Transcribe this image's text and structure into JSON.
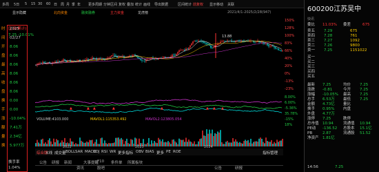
{
  "toolbar": {
    "items": [
      "多周",
      "5日",
      "5",
      "15",
      "30",
      "60",
      "日",
      "周",
      "月",
      "季",
      "年",
      "更多周期",
      "分钟区间",
      "复权",
      "叠加",
      "统计",
      "画线",
      "导出数据",
      "区间统计",
      "前复权",
      "显示移动",
      "关联"
    ],
    "active_index": 19
  },
  "toolbar2": {
    "items": [
      "显示隐藏",
      "北向资金",
      "融资融券",
      "主力资金",
      "龙虎榜"
    ],
    "date_range": "2021/4/1-2025/2/28(947)"
  },
  "left_panel": {
    "header": "区间(累计)",
    "subheader": "7.25 -10.01%",
    "rows": [
      {
        "label": "时",
        "value": "2025"
      },
      {
        "label": "间",
        "value": "02/27"
      },
      {
        "label": "开",
        "value": "8.06"
      },
      {
        "label": "盘",
        "value": "8.06"
      },
      {
        "label": "最",
        "value": "8.06"
      },
      {
        "label": "高",
        "value": "8.06"
      },
      {
        "label": "收",
        "value": "8.06"
      },
      {
        "label": "盘",
        "value": "8.06"
      },
      {
        "label": "换",
        "value": "0.00"
      },
      {
        "label": "手",
        "value": "0.00"
      },
      {
        "label": "涨",
        "value": "-10.04%"
      },
      {
        "label": "额",
        "value": "7.41万"
      },
      {
        "label": "量",
        "value": "2.34亿"
      },
      {
        "label": "换",
        "value": "5.977万"
      }
    ],
    "footer_label": "换手率",
    "footer_value": "1.04%"
  },
  "chart": {
    "peak_label": "13.88",
    "low_label": "5.70",
    "volume_title": "VOLUME:4103.000",
    "mavol1": "MAVOL1:115353.492",
    "mavol2": "MAVOL2:123805.054",
    "year_labels": [
      "2022",
      "2023",
      "2024"
    ],
    "legend_label": "日K叠加: 17.83"
  },
  "y_axis": {
    "price_ticks": [
      "150%",
      "128%",
      "100%",
      "83%",
      "66%",
      "40%",
      "20%",
      "0%",
      "-13%",
      "-23%"
    ],
    "vol_ticks": [
      "8.00%",
      "6.00%",
      "-5.36%",
      "35.78%",
      "-15%",
      "18%"
    ]
  },
  "tabs": {
    "items": [
      "综合版",
      "K线",
      "成交量",
      "BOLL",
      "SAR",
      "MACD",
      "KDJ",
      "RSI",
      "WR",
      "更多指标",
      "OBV",
      "BIAS",
      "更多",
      "PE",
      "ROE"
    ],
    "right_button": "指标管理"
  },
  "bottom_tabs": {
    "items": [
      "公告",
      "研报",
      "新闻",
      "大事提醒",
      "F10",
      "条件单",
      "所属板块"
    ]
  },
  "status": {
    "left": "资讯",
    "mid": "股吧",
    "right1": "公告",
    "right2": "研报"
  },
  "stock": {
    "code": "600200",
    "name": "江苏吴中",
    "subtitle": "快讯",
    "order_book_header": [
      "委比",
      "11.03%",
      "委差",
      "675"
    ],
    "asks": [
      {
        "label": "卖五",
        "price": "7.29",
        "vol": "675"
      },
      {
        "label": "卖四",
        "price": "7.28",
        "vol": "761"
      },
      {
        "label": "卖三",
        "price": "7.27",
        "vol": "1092"
      },
      {
        "label": "卖二",
        "price": "7.26",
        "vol": "9800"
      },
      {
        "label": "卖一",
        "price": "7.25",
        "vol": "1151022"
      }
    ],
    "bids": [
      {
        "label": "买一",
        "price": "",
        "vol": ""
      },
      {
        "label": "买二",
        "price": "",
        "vol": ""
      },
      {
        "label": "买三",
        "price": "",
        "vol": ""
      },
      {
        "label": "买四",
        "price": "",
        "vol": ""
      },
      {
        "label": "买五",
        "price": "",
        "vol": ""
      }
    ],
    "stats": [
      {
        "l1": "最新",
        "v1": "7.25",
        "l2": "均价",
        "v2": "7.25"
      },
      {
        "l1": "涨跌",
        "v1": "-0.81",
        "l2": "今开",
        "v2": "7.25"
      },
      {
        "l1": "涨幅",
        "v1": "-10.05%",
        "l2": "最高",
        "v2": "7.25"
      },
      {
        "l1": "总手",
        "v1": "6.53万",
        "l2": "最低",
        "v2": "7.25"
      },
      {
        "l1": "金额",
        "v1": "4.73亿",
        "l2": "量比",
        "v2": ""
      },
      {
        "l1": "换手",
        "v1": "0.95%",
        "l2": "内盘",
        "v2": ""
      },
      {
        "l1": "外盘",
        "v1": "4.77万",
        "l2": "",
        "v2": ""
      },
      {
        "l1": "涨停",
        "v1": "7.25",
        "l2": "跌停",
        "v2": ""
      },
      {
        "l1": "总市值",
        "v1": "10.94",
        "l2": "流通值",
        "v2": "10.94"
      },
      {
        "l1": "PE动",
        "v1": "-136.52",
        "l2": "总股本",
        "v2": "15.1亿"
      },
      {
        "l1": "PB",
        "v1": "2.87",
        "l2": "流通股",
        "v2": "51.52"
      },
      {
        "l1": "净资产",
        "v1": "1.81亿",
        "l2": "",
        "v2": ""
      }
    ],
    "trade_time": "14:56",
    "trade_price": "7.25"
  },
  "colors": {
    "up": "#ff3333",
    "down": "#00dddd",
    "accent_red": "#e02020",
    "yellow": "#ffcc00",
    "green": "#22cc44",
    "magenta": "#cc33cc"
  }
}
